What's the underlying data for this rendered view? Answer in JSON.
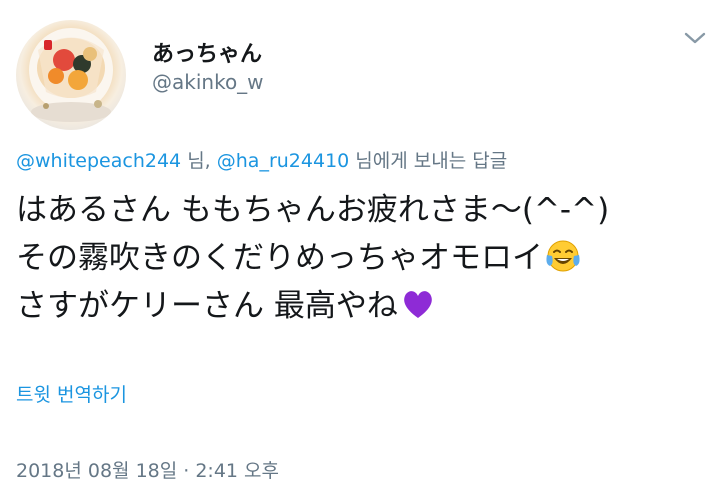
{
  "user": {
    "display_name": "あっちゃん",
    "handle": "@akinko_w"
  },
  "reply_context": {
    "mention_1": "@whitepeach244",
    "separator_1": " 님, ",
    "mention_2": "@ha_ru24410",
    "suffix": " 님에게 보내는 답글"
  },
  "tweet": {
    "line_1": "はあるさん ももちゃんお疲れさま〜(^-^)",
    "line_2": "その霧吹きのくだりめっちゃオモロイ",
    "line_3": "さすがケリーさん 最高やね",
    "emoji_1": "face-with-tears-of-joy-icon",
    "emoji_2": "purple-heart-icon"
  },
  "translate_label": "트윗 번역하기",
  "timestamp": "2018년 08월 18일 · 2:41 오후",
  "colors": {
    "link": "#1b95e0",
    "muted": "#657786",
    "text": "#14171a",
    "heart": "#8e2bd6"
  }
}
